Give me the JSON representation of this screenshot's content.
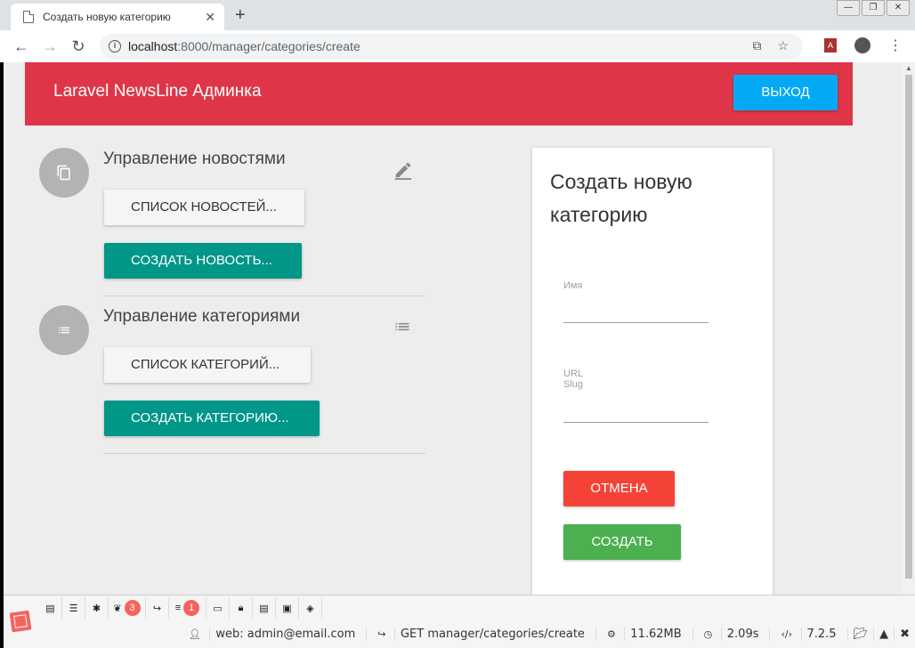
{
  "browser": {
    "tab_title": "Создать новую категорию",
    "tab_close": "✕",
    "new_tab": "+",
    "url_host": "localhost",
    "url_path": ":8000/manager/categories/create",
    "win_min": "—",
    "win_restore": "❐",
    "win_close": "✕"
  },
  "header": {
    "brand": "Laravel NewsLine Админка",
    "logout_label": "Выход"
  },
  "news_section": {
    "title": "Управление новостями",
    "list_button": "Список новостей...",
    "create_button": "Создать новость..."
  },
  "categories_section": {
    "title": "Управление категориями",
    "list_button": "Список категорий...",
    "create_button": "Создать категорию..."
  },
  "form": {
    "title": "Создать новую категорию",
    "name_label": "Имя",
    "slug_label": "URL\nSlug",
    "cancel_button": "Отмена",
    "submit_button": "Создать"
  },
  "debugbar": {
    "badge_views": "3",
    "badge_queries": "1",
    "user": "web: admin@email.com",
    "route": "GET manager/categories/create",
    "memory": "11.62MB",
    "time": "2.09s",
    "php_version": "7.2.5"
  },
  "colors": {
    "header": "#de3648",
    "logout": "#03a9f4",
    "teal": "#009688",
    "cancel": "#f44336",
    "submit": "#4caf50"
  }
}
